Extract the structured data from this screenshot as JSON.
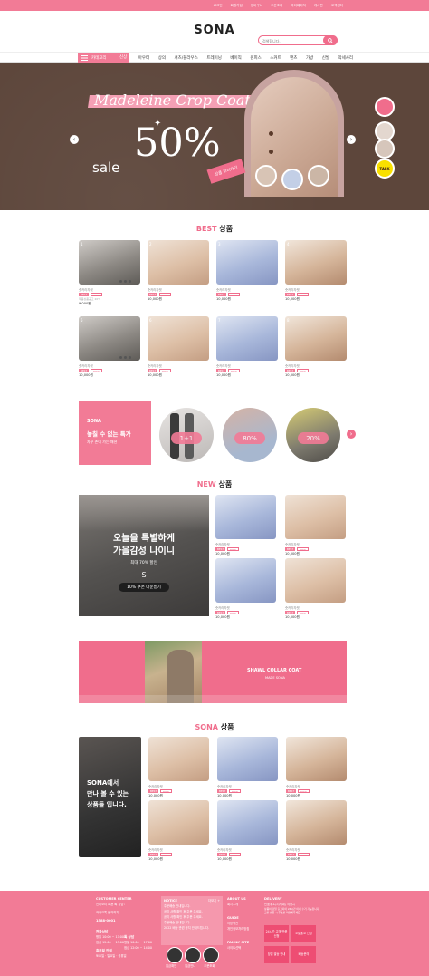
{
  "utility_links": [
    "로그인",
    "회원가입",
    "장바구니",
    "주문조회",
    "마이페이지",
    "게시판",
    "고객센터"
  ],
  "logo": "SONA",
  "search": {
    "placeholder": "검색합니다."
  },
  "nav": {
    "category_label": "카테고리",
    "items": [
      "신상",
      "아우터",
      "상의",
      "셔츠/블라우스",
      "트레이닝",
      "베이직",
      "원피스",
      "스커트",
      "팬츠",
      "가방",
      "신발",
      "악세사리"
    ]
  },
  "hero": {
    "title": "Madeleine Crop Coat",
    "sale_word": "sale",
    "sale_pct": "50%",
    "tag": "상품 보러가기",
    "side_badge": "TALK"
  },
  "best": {
    "title_hl": "BEST",
    "title_rest": "상품",
    "products": [
      {
        "num": "1",
        "brand": "숏카라자켓",
        "price": "9,000원",
        "sub": "제품상품공고 20%"
      },
      {
        "num": "2",
        "brand": "숏카라자켓",
        "price": "10,000원",
        "sub": ""
      },
      {
        "num": "3",
        "brand": "숏카라자켓",
        "price": "10,000원",
        "sub": ""
      },
      {
        "num": "4",
        "brand": "숏카라자켓",
        "price": "10,000원",
        "sub": ""
      },
      {
        "num": "5",
        "brand": "숏카라자켓",
        "price": "10,000원",
        "sub": ""
      },
      {
        "num": "6",
        "brand": "숏카라자켓",
        "price": "10,000원",
        "sub": ""
      },
      {
        "num": "7",
        "brand": "숏카라자켓",
        "price": "10,000원",
        "sub": ""
      },
      {
        "num": "8",
        "brand": "숏카라자켓",
        "price": "10,000원",
        "sub": ""
      }
    ],
    "badge1": "BEST",
    "badge2": "NEW"
  },
  "promo": {
    "brand": "SONA",
    "headline": "놓칠 수 없는 특가",
    "sub": "자꾸 손이 가는 패션",
    "circles": [
      "1+1",
      "80%",
      "20%"
    ]
  },
  "new_section": {
    "title_hl": "NEW",
    "title_rest": "상품",
    "big_line1": "오늘을 특별하게",
    "big_line2": "가을감성 나이니",
    "big_line3": "최대 70% 할인",
    "big_line4": "S",
    "coupon": "10% 쿠폰 다운받기",
    "products": [
      {
        "brand": "숏카라자켓",
        "price": "10,000원"
      },
      {
        "brand": "숏카라자켓",
        "price": "10,000원"
      },
      {
        "brand": "숏카라자켓",
        "price": "10,000원"
      },
      {
        "brand": "숏카라자켓",
        "price": "10,000원"
      }
    ]
  },
  "banner2": {
    "title": "SHAWL COLLAR COAT",
    "sub": "MADE SONA"
  },
  "sona_section": {
    "title_hl": "SONA",
    "title_rest": "상품",
    "big_text": [
      "SONA에서",
      "만나 볼 수 있는",
      "상품들 입니다."
    ],
    "products": [
      {
        "brand": "숏카라자켓",
        "price": "10,000원"
      },
      {
        "brand": "숏카라자켓",
        "price": "10,000원"
      },
      {
        "brand": "숏카라자켓",
        "price": "10,000원"
      },
      {
        "brand": "숏카라자켓",
        "price": "10,000원"
      },
      {
        "brand": "숏카라자켓",
        "price": "10,000원"
      },
      {
        "brand": "숏카라자켓",
        "price": "10,000원"
      }
    ]
  },
  "footer": {
    "cs_title": "CUSTOMER CENTER",
    "cs_lines": [
      "전화보다 빠른 톡 상담!",
      "",
      "카카오톡 문의하기",
      "",
      "1588-0001"
    ],
    "bank_title": "전화상담",
    "bank_lines": [
      "평일 10:00 ~ 17:00",
      "점심 12:00 ~ 13:00"
    ],
    "bank2_title": "톡 상담",
    "bank2_lines": [
      "평일 10:00 ~ 17:00",
      "점심 12:00 ~ 14:00"
    ],
    "hours_title": "휴무일 안내",
    "hours_lines": [
      "토요일 · 일요일 · 공휴일"
    ],
    "notice_title": "NOTICE",
    "notice_more": "더보기 +",
    "notice_lines": [
      "주문배송 안내입니다.",
      "공지 사항 확인 후 주문 주세요.",
      "공지 사항 확인 후 주문 주세요.",
      "주문배송 안내입니다.",
      "2022 배송 관련 공지 안내드립니다."
    ],
    "circle_labels": [
      "입금확인",
      "입금안내",
      "주문조회"
    ],
    "about_title": "ABOUT US",
    "about_lines": [
      "회사소개"
    ],
    "guide_title": "GUIDE",
    "guide_lines": [
      "이용약관",
      "개인정보처리방침"
    ],
    "family_title": "FAMILY SITE",
    "family_lines": [
      "사이트선택"
    ],
    "delivery_title": "DELIVERY",
    "delivery_lines": [
      "반품주소(CJ택배) 이용시",
      "상품이 당일 출고되어 24시간 이내 수거 가능합니다.",
      "교환·반품 시 주소를 확인해주세요."
    ],
    "delivery_btns": [
      "24시간 고객 반품 신청",
      "오늘출고 신청",
      "당일 발송 안내",
      "배송문의"
    ]
  }
}
